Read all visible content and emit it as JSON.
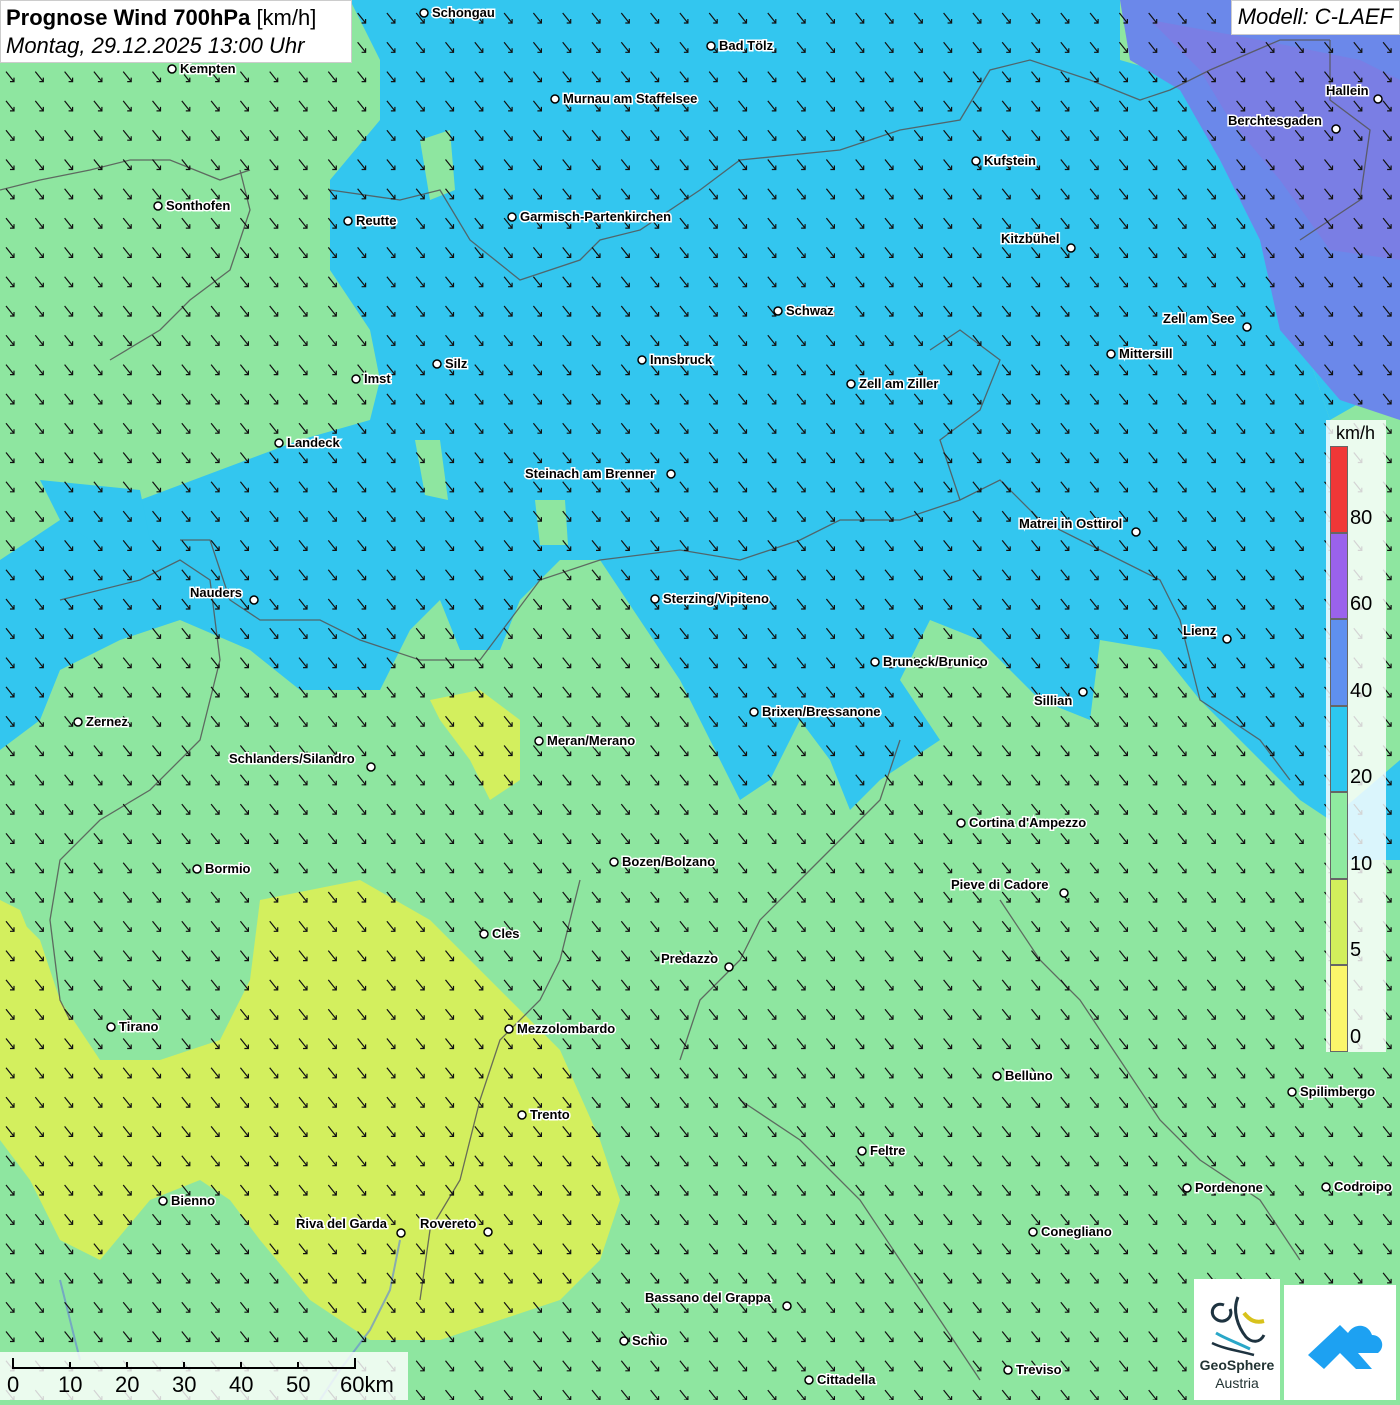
{
  "header": {
    "title_bold": "Prognose Wind 700hPa",
    "title_unit": "[km/h]",
    "datetime": "Montag, 29.12.2025 13:00 Uhr",
    "model": "Modell: C-LAEF"
  },
  "legend": {
    "unit": "km/h",
    "classes": [
      {
        "min": 80,
        "color": "#f03737",
        "label": "80"
      },
      {
        "min": 60,
        "color": "#9a62ec",
        "label": "60"
      },
      {
        "min": 40,
        "color": "#5f90ef",
        "label": "40"
      },
      {
        "min": 20,
        "color": "#2dc7f0",
        "label": "20"
      },
      {
        "min": 10,
        "color": "#8feaa0",
        "label": "10"
      },
      {
        "min": 5,
        "color": "#d2ef5c",
        "label": "5"
      },
      {
        "min": 0,
        "color": "#fbf66b",
        "label": "0"
      }
    ]
  },
  "scalebar": {
    "labels": [
      "0",
      "10",
      "20",
      "30",
      "40",
      "50",
      "60km"
    ]
  },
  "logo": {
    "name_line1": "GeoSphere",
    "name_line2": "Austria"
  },
  "cities": [
    {
      "name": "Schongau"
    },
    {
      "name": "Bad Tölz"
    },
    {
      "name": "Kempten"
    },
    {
      "name": "Murnau am Staffelsee"
    },
    {
      "name": "Hallein"
    },
    {
      "name": "Berchtesgaden"
    },
    {
      "name": "Kufstein"
    },
    {
      "name": "Sonthofen"
    },
    {
      "name": "Reutte"
    },
    {
      "name": "Garmisch-Partenkirchen"
    },
    {
      "name": "Kitzbühel"
    },
    {
      "name": "Schwaz"
    },
    {
      "name": "Zell am See"
    },
    {
      "name": "Mittersill"
    },
    {
      "name": "Innsbruck"
    },
    {
      "name": "Silz"
    },
    {
      "name": "Imst"
    },
    {
      "name": "Zell am Ziller"
    },
    {
      "name": "Landeck"
    },
    {
      "name": "Steinach am Brenner"
    },
    {
      "name": "Matrei in Osttirol"
    },
    {
      "name": "Nauders"
    },
    {
      "name": "Sterzing/Vipiteno"
    },
    {
      "name": "Lienz"
    },
    {
      "name": "Bruneck/Brunico"
    },
    {
      "name": "Sillian"
    },
    {
      "name": "Zernez"
    },
    {
      "name": "Brixen/Bressanone"
    },
    {
      "name": "Meran/Merano"
    },
    {
      "name": "Schlanders/Silandro"
    },
    {
      "name": "Cortina d'Ampezzo"
    },
    {
      "name": "Bozen/Bolzano"
    },
    {
      "name": "Bormio"
    },
    {
      "name": "Pieve di Cadore"
    },
    {
      "name": "Cles"
    },
    {
      "name": "Predazzo"
    },
    {
      "name": "Tirano"
    },
    {
      "name": "Mezzolombardo"
    },
    {
      "name": "Belluno"
    },
    {
      "name": "Spilimbergo"
    },
    {
      "name": "Trento"
    },
    {
      "name": "Feltre"
    },
    {
      "name": "Pordenone"
    },
    {
      "name": "Codroipo"
    },
    {
      "name": "Bienno"
    },
    {
      "name": "Riva del Garda"
    },
    {
      "name": "Rovereto"
    },
    {
      "name": "Conegliano"
    },
    {
      "name": "Bassano del Grappa"
    },
    {
      "name": "Schio"
    },
    {
      "name": "Treviso"
    },
    {
      "name": "Cittadella"
    }
  ]
}
